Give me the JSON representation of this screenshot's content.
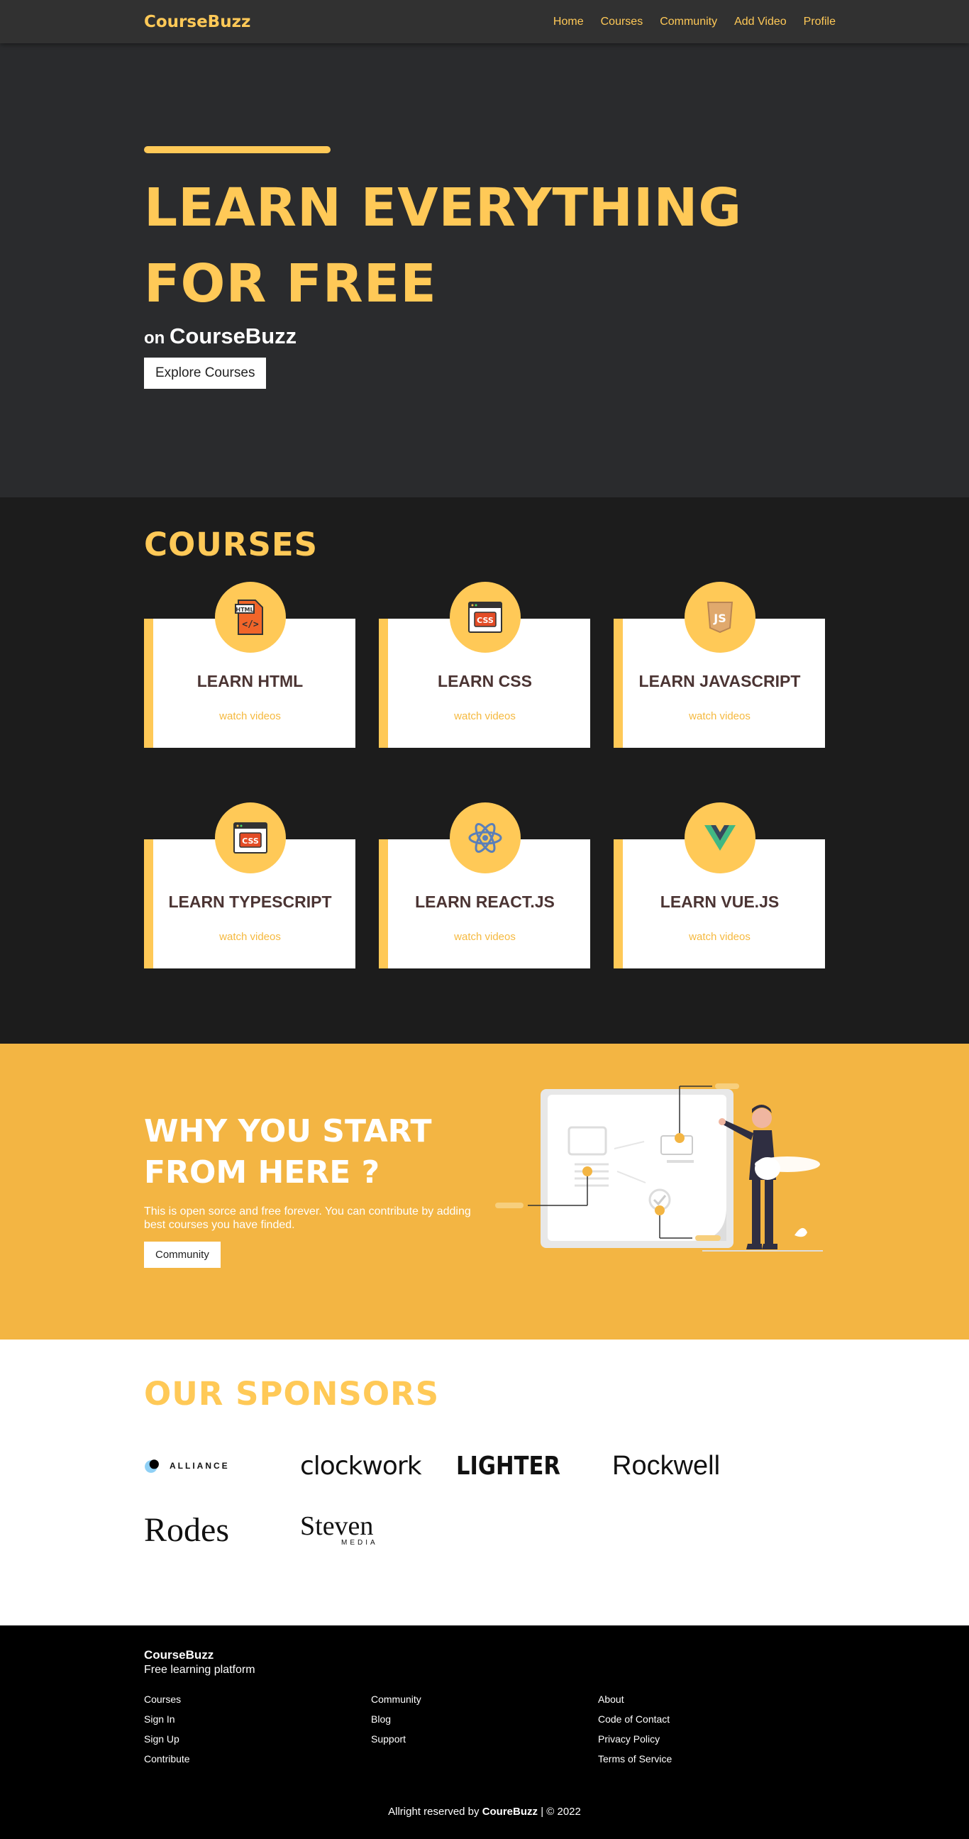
{
  "nav": {
    "brand": "CourseBuzz",
    "links": [
      "Home",
      "Courses",
      "Community",
      "Add Video",
      "Profile"
    ]
  },
  "hero": {
    "title_line1": "LEARN EVERYTHING",
    "title_line2": "FOR FREE",
    "sub_prefix": "on",
    "sub_brand": "CourseBuzz",
    "button": "Explore Courses"
  },
  "courses": {
    "title": "COURSES",
    "items": [
      {
        "title": "LEARN HTML",
        "link": "watch videos",
        "icon": "html-file-icon"
      },
      {
        "title": "LEARN CSS",
        "link": "watch videos",
        "icon": "css-window-icon"
      },
      {
        "title": "LEARN JAVASCRIPT",
        "link": "watch videos",
        "icon": "js-shield-icon"
      },
      {
        "title": "LEARN TYPESCRIPT",
        "link": "watch videos",
        "icon": "css-window-icon"
      },
      {
        "title": "LEARN REACT.JS",
        "link": "watch videos",
        "icon": "react-atom-icon"
      },
      {
        "title": "LEARN VUE.JS",
        "link": "watch videos",
        "icon": "vue-logo-icon"
      }
    ]
  },
  "why": {
    "title_line1": "WHY YOU START",
    "title_line2": "FROM HERE ?",
    "text": "This is open sorce and free forever. You can contribute by adding best courses you have finded.",
    "button": "Community"
  },
  "sponsors": {
    "title": "OUR SPONSORS",
    "logos": [
      "ALLIANCE",
      "clockwork",
      "LIGHTER",
      "Rockwell",
      "Rodes",
      "Steven",
      "MEDIA"
    ]
  },
  "footer": {
    "brand": "CourseBuzz",
    "tagline": "Free learning platform",
    "col1": [
      "Courses",
      "Sign In",
      "Sign Up",
      "Contribute"
    ],
    "col2": [
      "Community",
      "Blog",
      "Support"
    ],
    "col3": [
      "About",
      "Code of Contact",
      "Privacy Policy",
      "Terms of Service"
    ],
    "copy_prefix": "Allright reserved by",
    "copy_brand": "CoureBuzz",
    "copy_suffix": "| © 2022"
  },
  "colors": {
    "accent": "#ffc957",
    "yellow_bg": "#f3b543",
    "dark": "#2a2b2d",
    "text_dark": "#4b3433"
  }
}
